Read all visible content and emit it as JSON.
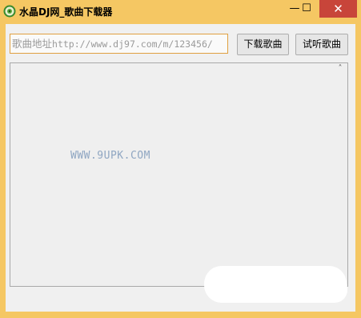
{
  "window": {
    "title": "水晶DJ网_歌曲下载器",
    "minimize_symbol": "—",
    "maximize_symbol": "☐",
    "close_symbol": "✕"
  },
  "form": {
    "url_placeholder_cn": "歌曲地址",
    "url_placeholder_url": "http://www.dj97.com/m/123456/",
    "download_button": "下载歌曲",
    "listen_button": "试听歌曲"
  },
  "panel": {
    "scroll_up_symbol": "˄",
    "watermark": "WWW.9UPK.COM"
  },
  "colors": {
    "window_frame": "#f5c763",
    "close_button": "#c8453a",
    "input_border": "#e0a040"
  },
  "icons": {
    "app": "crystal-dj-logo-icon"
  }
}
